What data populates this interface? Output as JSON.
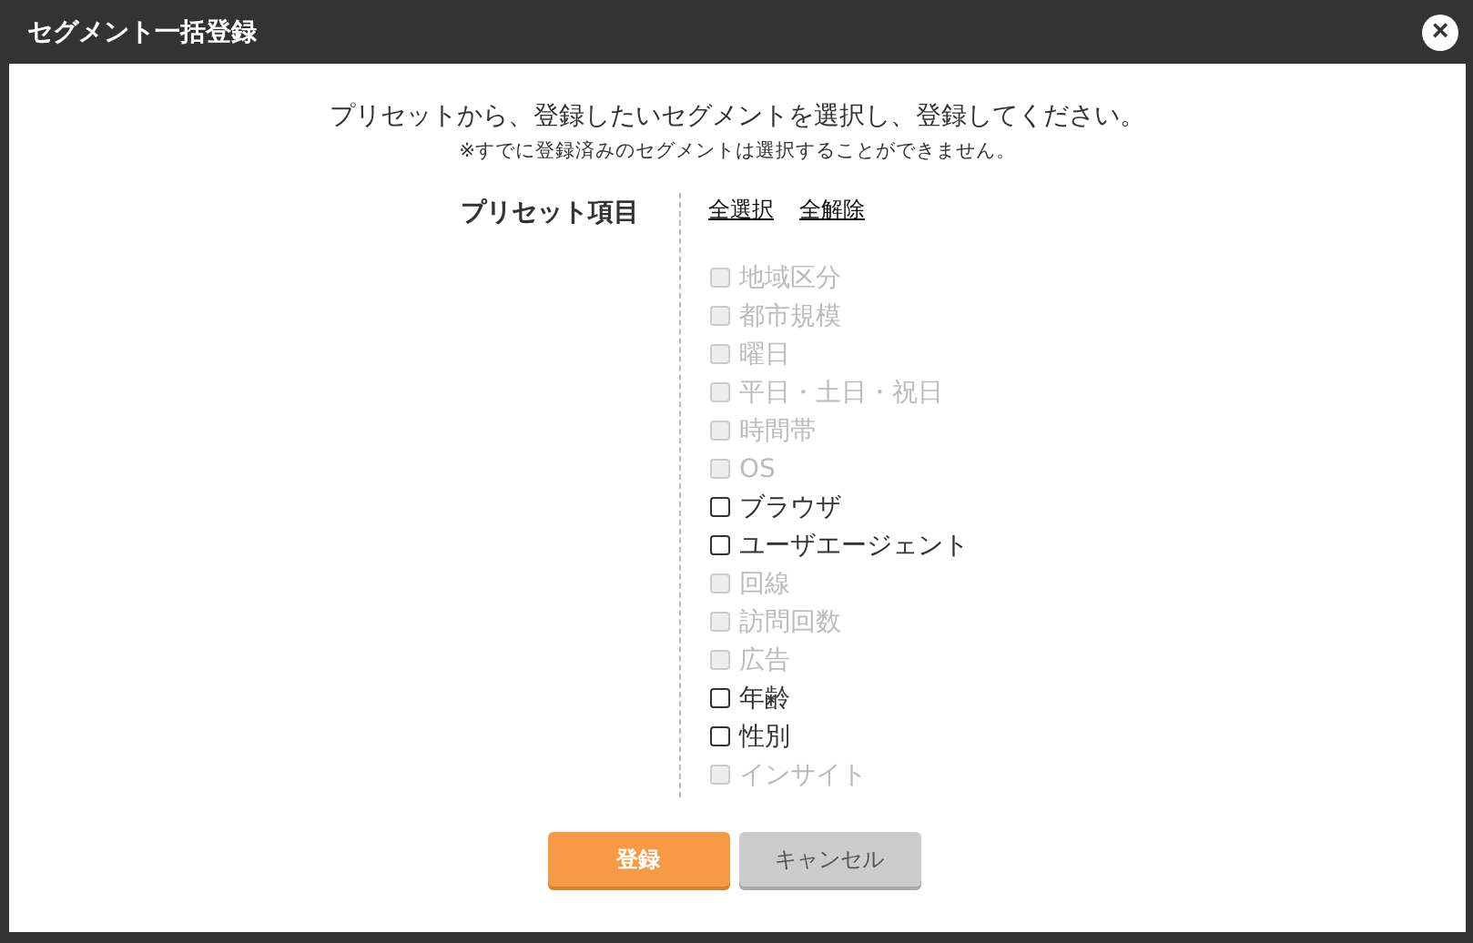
{
  "window": {
    "title": "セグメント一括登録",
    "close": "×"
  },
  "intro": "プリセットから、登録したいセグメントを選択し、登録してください。",
  "note": "※すでに登録済みのセグメントは選択することができません。",
  "preset": {
    "label": "プリセット項目",
    "links": [
      "全選択",
      "全解除"
    ],
    "items": [
      {
        "label": "地域区分",
        "checked": false,
        "disabled": true
      },
      {
        "label": "都市規模",
        "checked": false,
        "disabled": true
      },
      {
        "label": "曜日",
        "checked": false,
        "disabled": true
      },
      {
        "label": "平日・土日・祝日",
        "checked": false,
        "disabled": true
      },
      {
        "label": "時間帯",
        "checked": false,
        "disabled": true
      },
      {
        "label": "OS",
        "checked": false,
        "disabled": true
      },
      {
        "label": "ブラウザ",
        "checked": false,
        "disabled": false
      },
      {
        "label": "ユーザエージェント",
        "checked": false,
        "disabled": false
      },
      {
        "label": "回線",
        "checked": false,
        "disabled": true
      },
      {
        "label": "訪問回数",
        "checked": false,
        "disabled": true
      },
      {
        "label": "広告",
        "checked": false,
        "disabled": true
      },
      {
        "label": "年齢",
        "checked": false,
        "disabled": false
      },
      {
        "label": "性別",
        "checked": false,
        "disabled": false
      },
      {
        "label": "インサイト",
        "checked": false,
        "disabled": true
      }
    ]
  },
  "buttons": [
    {
      "label": "登録",
      "kind": "primary"
    },
    {
      "label": "キャンセル",
      "kind": "secondary"
    }
  ]
}
